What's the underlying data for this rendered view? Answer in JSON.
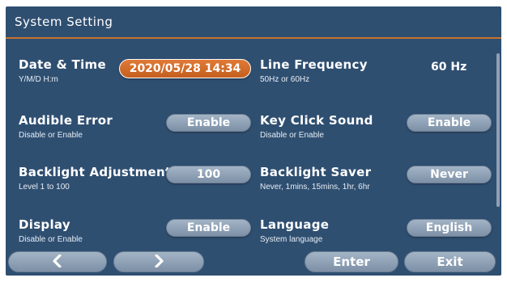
{
  "header": {
    "title": "System Setting"
  },
  "settings": {
    "date_time": {
      "label": "Date & Time",
      "desc": "Y/M/D H:m",
      "value": "2020/05/28 14:34"
    },
    "line_frequency": {
      "label": "Line Frequency",
      "desc": "50Hz or 60Hz",
      "value": "60 Hz"
    },
    "audible_error": {
      "label": "Audible Error",
      "desc": "Disable or Enable",
      "value": "Enable"
    },
    "key_click_sound": {
      "label": "Key Click Sound",
      "desc": "Disable or Enable",
      "value": "Enable"
    },
    "backlight_adjustment": {
      "label": "Backlight Adjustment",
      "desc": "Level 1 to 100",
      "value": "100"
    },
    "backlight_saver": {
      "label": "Backlight Saver",
      "desc": "Never, 1mins, 15mins, 1hr, 6hr",
      "value": "Never"
    },
    "display": {
      "label": "Display",
      "desc": "Disable or Enable",
      "value": "Enable"
    },
    "language": {
      "label": "Language",
      "desc": "System language",
      "value": "English"
    }
  },
  "footer": {
    "prev_icon": "chevron-left-icon",
    "next_icon": "chevron-right-icon",
    "enter_label": "Enter",
    "exit_label": "Exit"
  },
  "colors": {
    "background": "#2f4f71",
    "accent": "#c9712e",
    "button": "#8fa2b7"
  }
}
